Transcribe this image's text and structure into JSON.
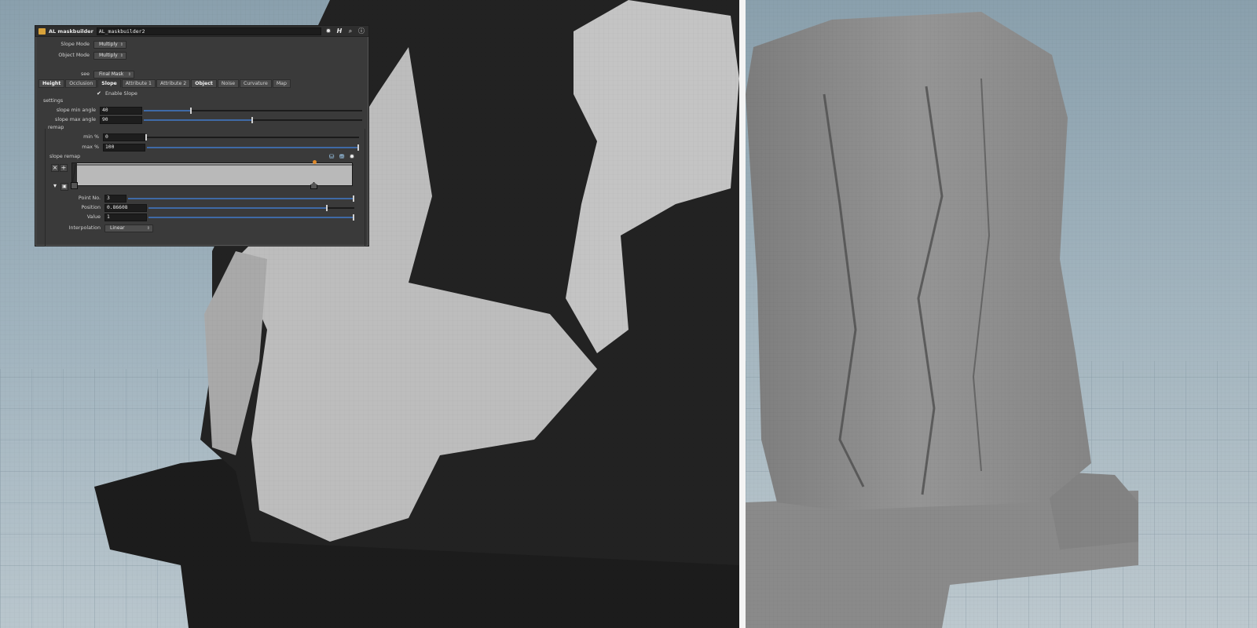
{
  "panel": {
    "node_type": "AL maskbuilder",
    "node_name": "AL_maskbuilder2",
    "slope_mode_label": "Slope Mode",
    "slope_mode_value": "Multiply",
    "object_mode_label": "Object Mode",
    "object_mode_value": "Multiply",
    "see_label": "see",
    "see_value": "Final Mask",
    "tabs": [
      "Height",
      "Occlusion",
      "Slope",
      "Attribute 1",
      "Attribute 2",
      "Object",
      "Noise",
      "Curvature",
      "Map"
    ],
    "enable_slope_label": "Enable Slope",
    "settings_label": "settings",
    "slope_min_label": "slope min angle",
    "slope_min_value": "40",
    "slope_max_label": "slope max angle",
    "slope_max_value": "90",
    "remap_label": "remap",
    "min_pct_label": "min %",
    "min_pct_value": "0",
    "max_pct_label": "max %",
    "max_pct_value": "100",
    "slope_remap_label": "slope remap",
    "point_no_label": "Point No.",
    "point_no_value": "3",
    "position_label": "Position",
    "position_value": "0.86608",
    "value_label": "Value",
    "value_value": "1",
    "interpolation_label": "Interpolation",
    "interpolation_value": "Linear"
  },
  "sliders": {
    "slope_min_fraction": 0.22,
    "slope_max_fraction": 0.5,
    "min_pct_fraction": 0.0,
    "max_pct_fraction": 1.0,
    "point_no_fraction": 1.0,
    "position_fraction": 0.87,
    "value_fraction": 1.0
  },
  "colors": {
    "panel_bg": "#3a3a3a",
    "slider_fill": "#3f6aa6",
    "mask_dark": "#1e1e1e",
    "mask_light": "#c9c9c9",
    "mesh_gray": "#8e8e8e"
  },
  "icons": {
    "node_icon": "maskbuilder-node-icon",
    "gear": "gear-icon",
    "help": "help-icon",
    "search": "search-icon",
    "info": "info-icon"
  }
}
